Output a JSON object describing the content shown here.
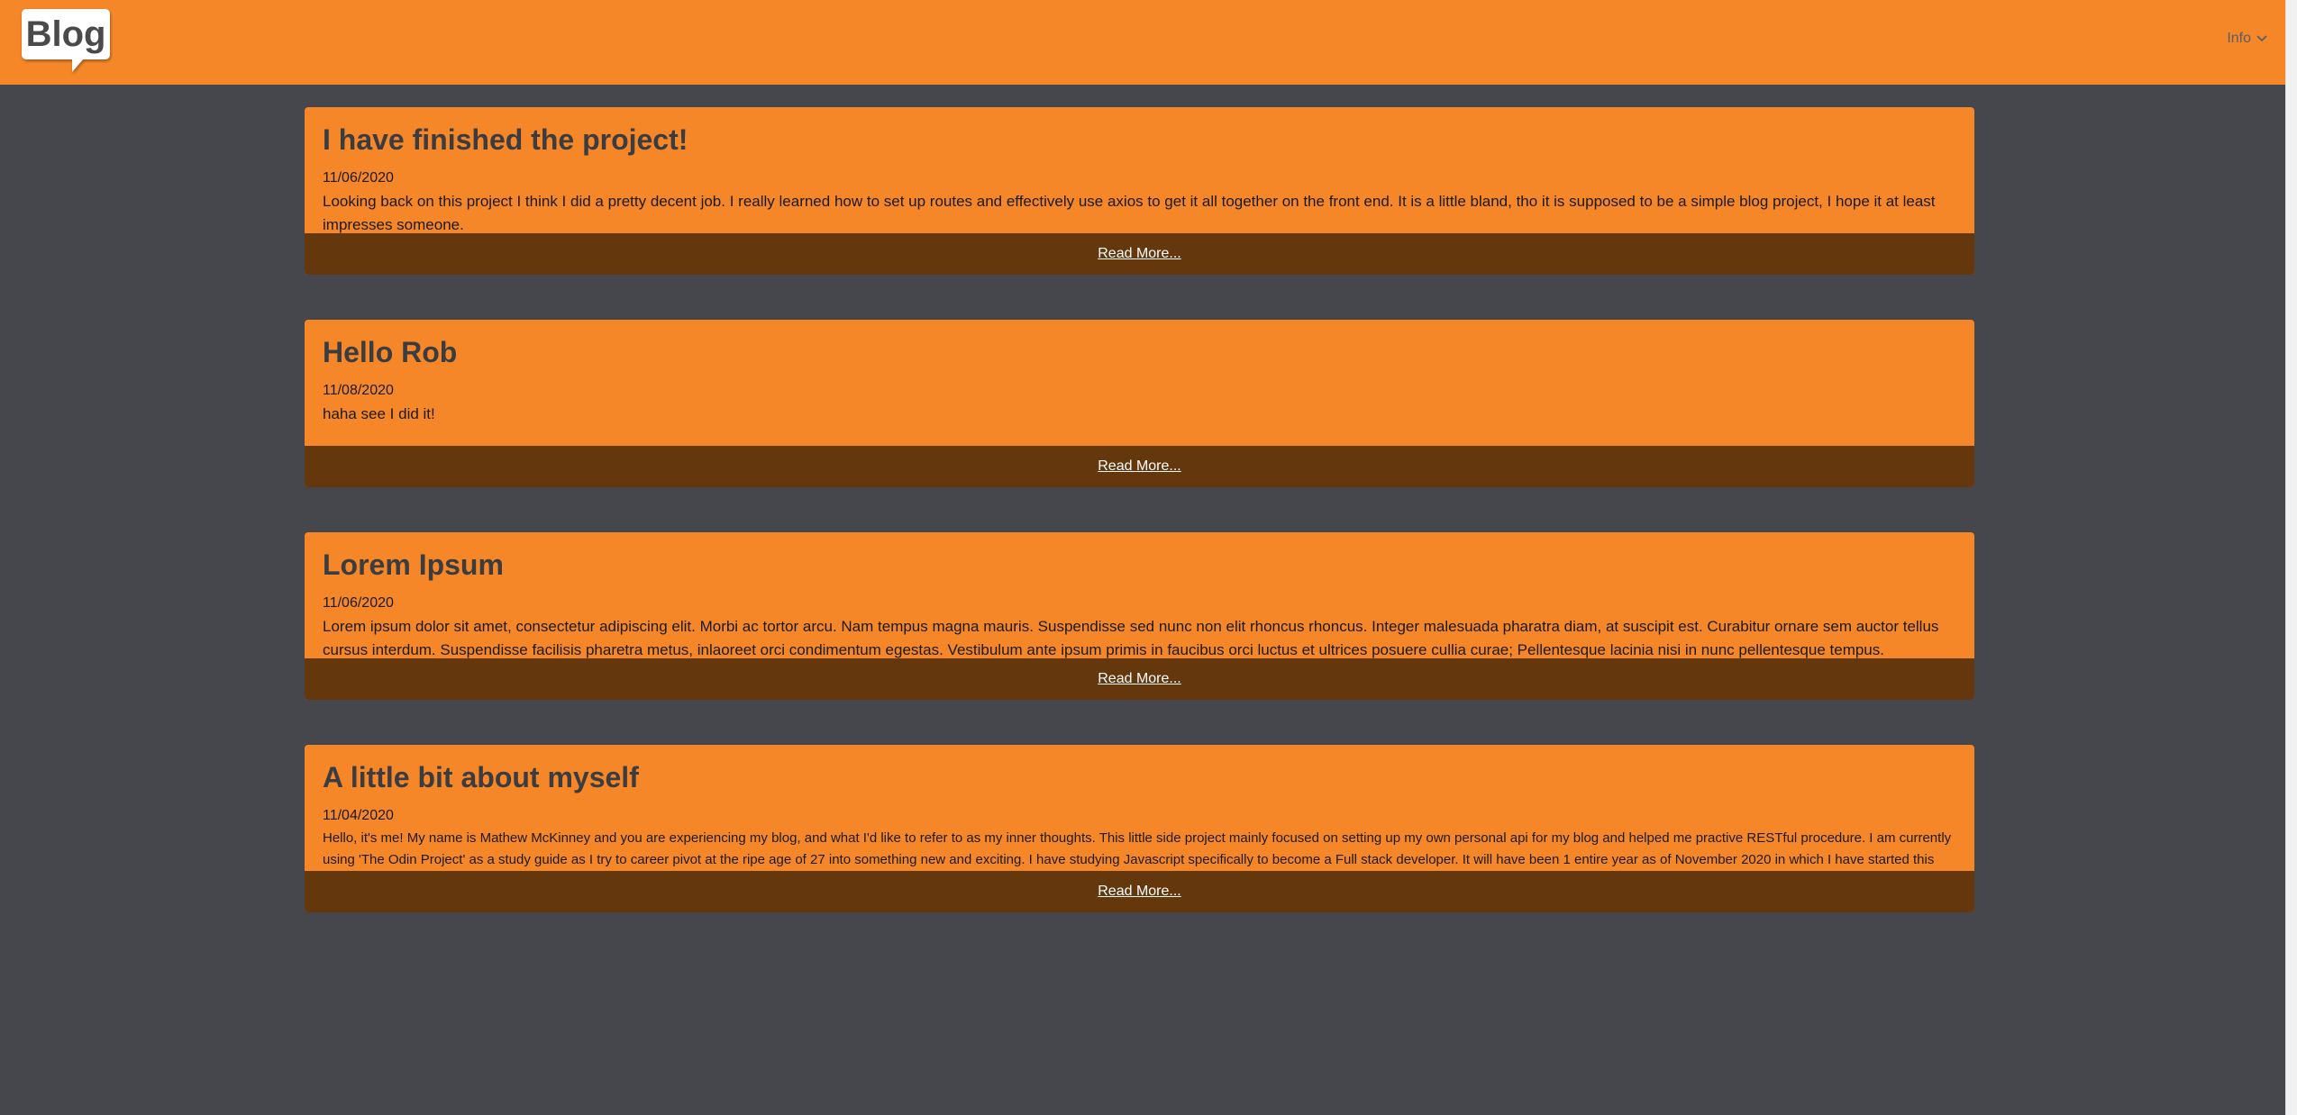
{
  "header": {
    "logo_text": "Blog",
    "info_label": "Info"
  },
  "colors": {
    "accent": "#f58729",
    "background": "#45474c",
    "overlay": "#5f3510",
    "title_text": "#3b3c40"
  },
  "posts": [
    {
      "title": "I have finished the project!",
      "date": "11/06/2020",
      "body": "Looking back on this project I think I did a pretty decent job. I really learned how to set up routes and effectively use axios to get it all together on the front end. It is a little bland, tho it is supposed to be a simple blog project, I hope it at least impresses someone.",
      "read_more": "Read More..."
    },
    {
      "title": "Hello Rob",
      "date": "11/08/2020",
      "body": "haha see I did it!",
      "read_more": "Read More..."
    },
    {
      "title": "Lorem Ipsum",
      "date": "11/06/2020",
      "body": "Lorem ipsum dolor sit amet, consectetur adipiscing elit. Morbi ac tortor arcu. Nam tempus magna mauris. Suspendisse sed nunc non elit rhoncus rhoncus. Integer malesuada pharatra diam, at suscipit est. Curabitur ornare sem auctor tellus cursus interdum. Suspendisse facilisis pharetra metus, inlaoreet orci condimentum egestas. Vestibulum ante ipsum primis in faucibus orci luctus et ultrices posuere cullia curae; Pellentesque lacinia nisi in nunc pellentesque tempus. Suspendisse a libero a elit aliquam vehicula eu nec augue. Praesent dictum sapien nunc, et hendreirt tortor tincidunt id. Nulla vel sapien consequat, venenantis nibh vel, eleifednd nunc. Sed tellus",
      "read_more": "Read More..."
    },
    {
      "title": "A little bit about myself",
      "date": "11/04/2020",
      "body": "Hello, it's me! My name is Mathew McKinney and you are experiencing my blog, and what I'd like to refer to as my inner thoughts. This little side project mainly focused on setting up my own personal api for my blog and helped me practive RESTful procedure. I am currently using 'The Odin Project' as a study guide as I try to career pivot at the ripe age of 27 into something new and exciting. I have studying Javascript specifically to become a Full stack developer. It will have been 1 entire year as of November 2020 in which I have started this journey! I feel like I have learned a lot, and at the same time I feel like I've learned very little. Come and check out my other projects/repos on my git hub and let me know what you think",
      "read_more": "Read More..."
    }
  ]
}
